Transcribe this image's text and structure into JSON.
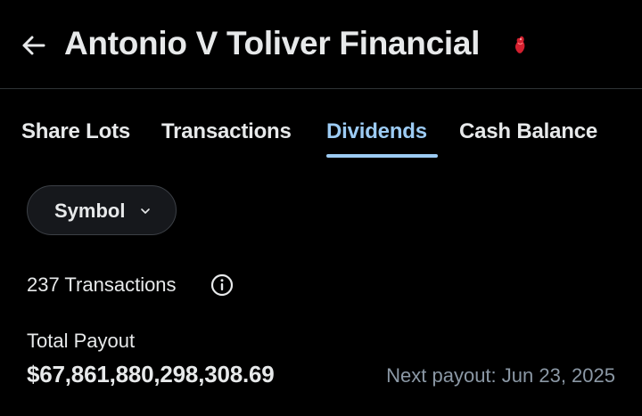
{
  "header": {
    "title": "Antonio V Toliver Financial",
    "back_icon": "arrow-left-icon",
    "badge_icon": "heart-icon",
    "badge_color": "#e0245e"
  },
  "tabs": [
    {
      "label": "Share Lots",
      "active": false
    },
    {
      "label": "Transactions",
      "active": false
    },
    {
      "label": "Dividends",
      "active": true
    },
    {
      "label": "Cash Balance",
      "active": false
    }
  ],
  "filter": {
    "label": "Symbol",
    "icon": "chevron-down-icon"
  },
  "summary": {
    "transactions_count": "237 Transactions",
    "info_icon": "info-icon",
    "total_payout_label": "Total Payout",
    "total_payout_value": "$67,861,880,298,308.69",
    "next_payout": "Next payout: Jun 23, 2025"
  },
  "colors": {
    "background": "#000000",
    "text": "#e7e9ea",
    "accent": "#9ccbf3",
    "muted": "#8b98a5",
    "divider": "#2f3336"
  }
}
